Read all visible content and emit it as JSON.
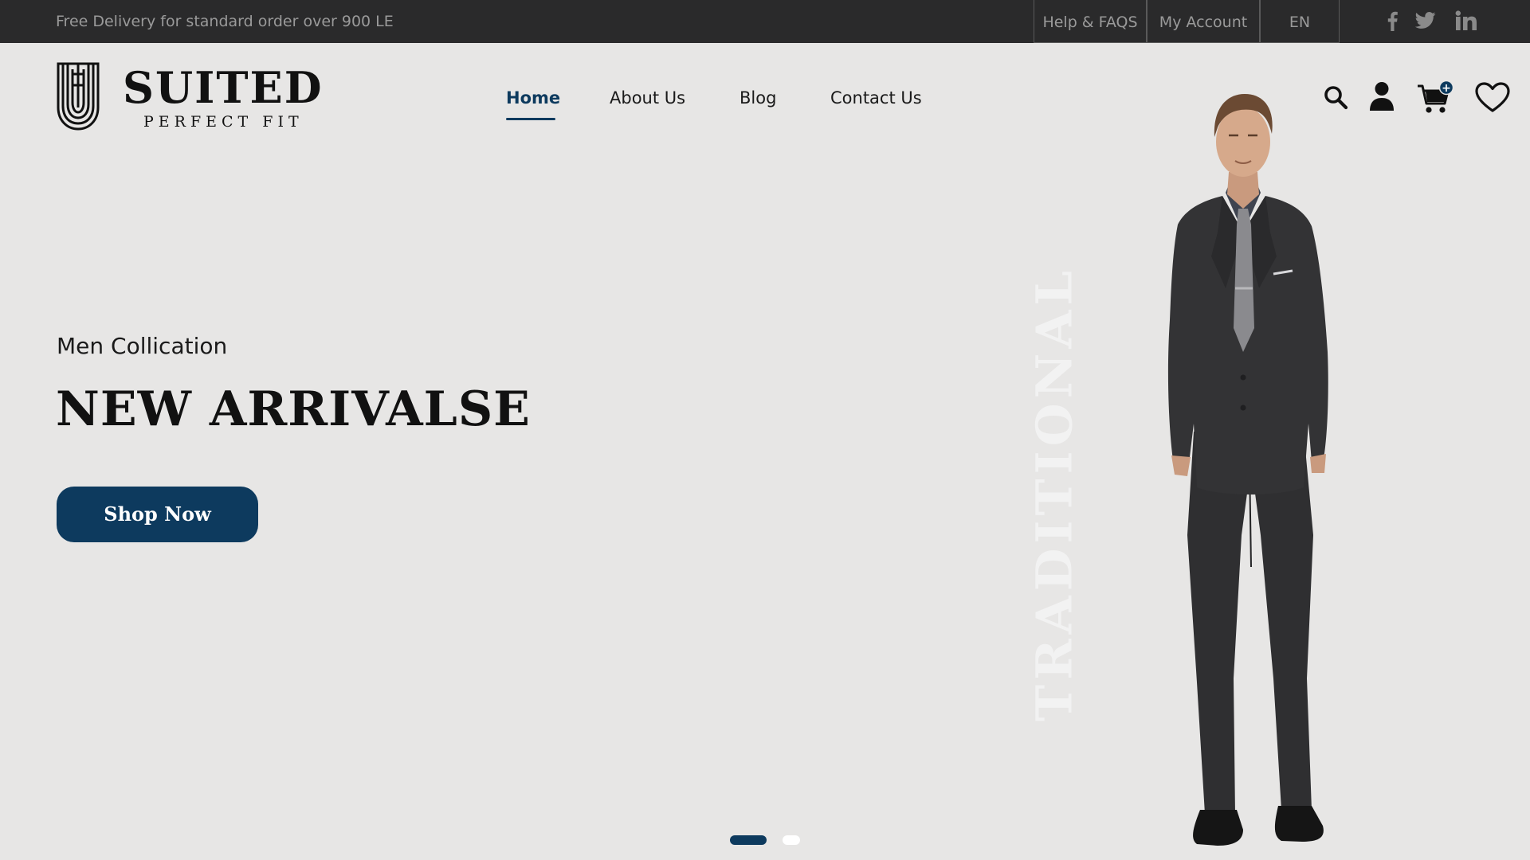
{
  "topbar": {
    "promo": "Free Delivery for standard order over 900 LE",
    "links": {
      "help": "Help & FAQS",
      "account": "My Account",
      "language": "EN"
    },
    "social_icons": [
      "facebook-icon",
      "twitter-icon",
      "linkedin-icon"
    ]
  },
  "logo": {
    "name": "SUITED",
    "tagline": "PERFECT FIT"
  },
  "nav": {
    "items": [
      {
        "label": "Home",
        "active": true
      },
      {
        "label": "About Us",
        "active": false
      },
      {
        "label": "Blog",
        "active": false
      },
      {
        "label": "Contact Us",
        "active": false
      }
    ]
  },
  "header_icons": [
    "search-icon",
    "user-icon",
    "cart-icon",
    "heart-icon"
  ],
  "cart_badge": "+",
  "hero": {
    "eyebrow": "Men Collication",
    "title": "NEW ARRIVALSE",
    "cta": "Shop Now",
    "vertical_word": "TRADITIONAL"
  },
  "carousel": {
    "slides": 2,
    "active_index": 0
  },
  "colors": {
    "accent": "#0d3a5e",
    "topbar_bg": "#2a2a2b",
    "page_bg": "#e7e6e5"
  }
}
